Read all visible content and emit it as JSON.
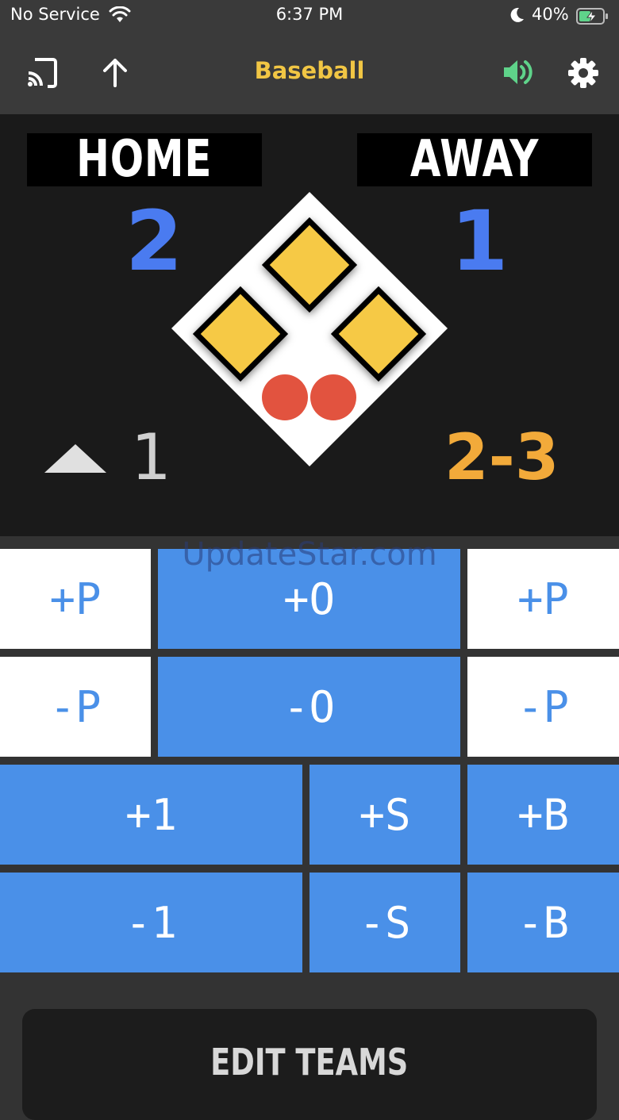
{
  "status": {
    "carrier": "No Service",
    "time": "6:37 PM",
    "battery": "40%"
  },
  "toolbar": {
    "title": "Baseball",
    "left_icons": [
      "cast-icon",
      "share-up-arrow-icon"
    ],
    "right_icons": [
      "speaker-icon",
      "gear-icon"
    ],
    "colors": {
      "title": "#f1c644",
      "speaker": "#5fd38a"
    }
  },
  "scoreboard": {
    "home": {
      "label": "HOME",
      "score": "2"
    },
    "away": {
      "label": "AWAY",
      "score": "1"
    },
    "inning": {
      "half": "top",
      "number": "1"
    },
    "count": "2-3",
    "outs": 2,
    "bases_occupied": {
      "first": true,
      "second": true,
      "third": true
    },
    "colors": {
      "score": "#4a7bf0",
      "count": "#f2aa3a",
      "base": "#f6c944",
      "out": "#e2533f"
    }
  },
  "watermark": "UpdateStar.com",
  "pad": {
    "home_plus_p": "+P",
    "plus_o": "+O",
    "away_plus_p": "+P",
    "home_minus_p": "-P",
    "minus_o": "-O",
    "away_minus_p": "-P",
    "plus_1": "+1",
    "plus_s": "+S",
    "plus_b": "+B",
    "minus_1": "-1",
    "minus_s": "-S",
    "minus_b": "-B"
  },
  "edit_teams": "EDIT TEAMS"
}
